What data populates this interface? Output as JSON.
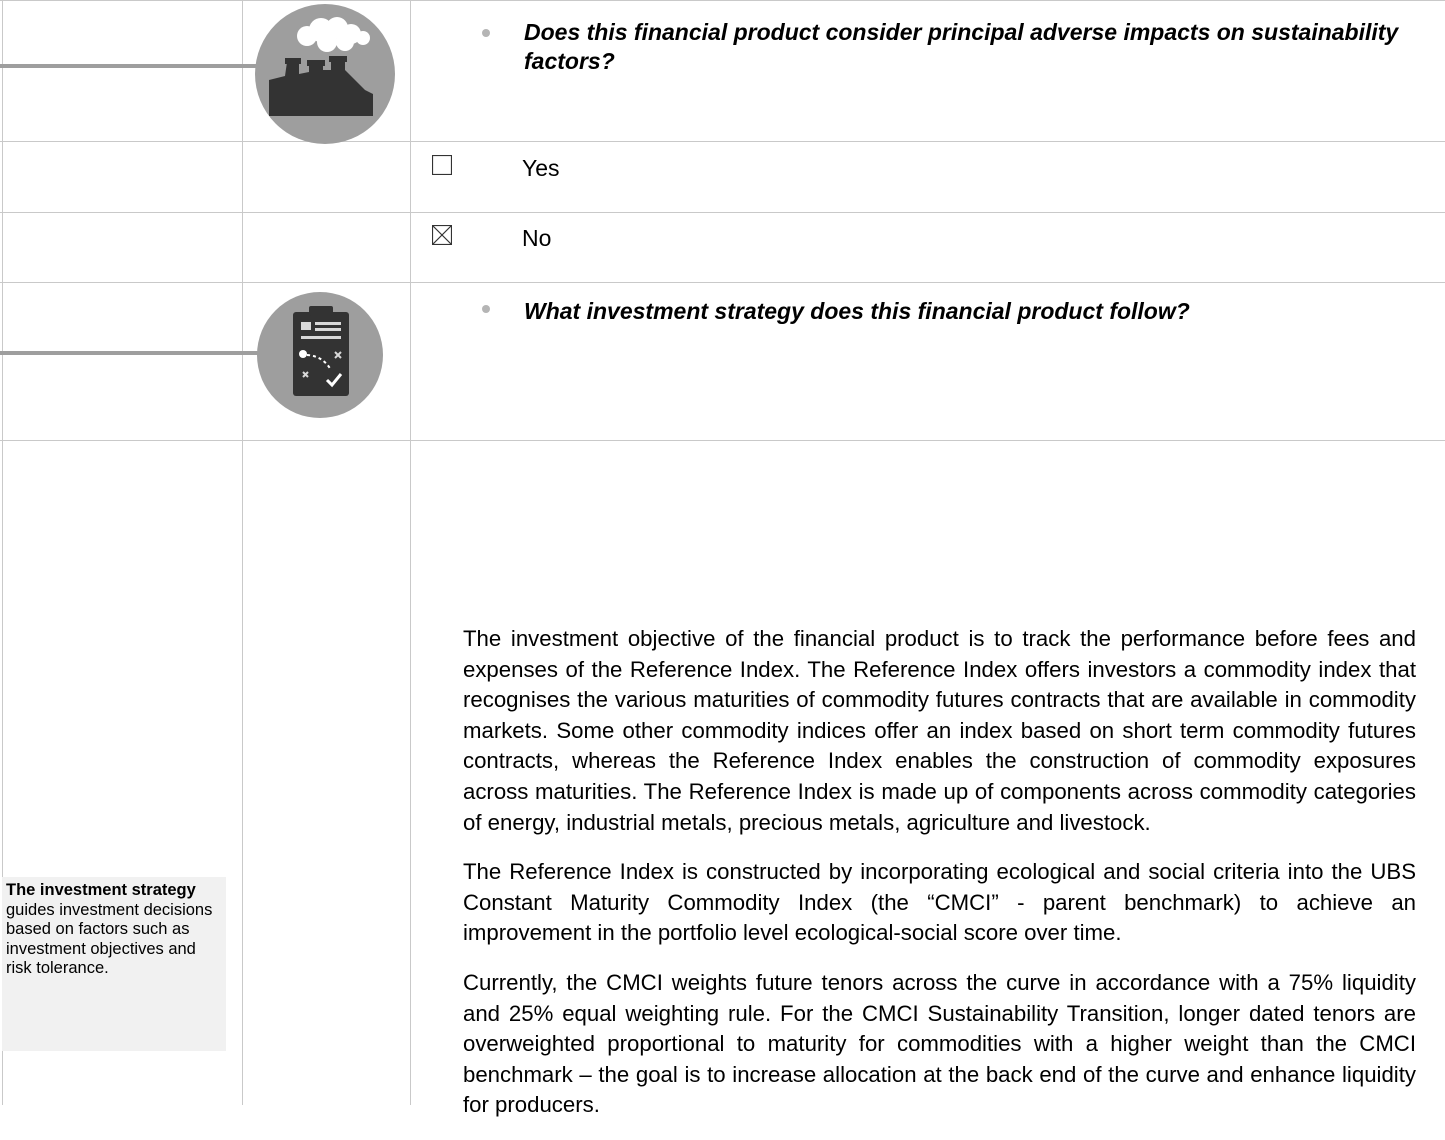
{
  "questions": {
    "pai": "Does this financial product consider principal adverse impacts on sustainability factors?",
    "strategy": "What investment strategy does this financial product follow?"
  },
  "options": [
    {
      "label": "Yes",
      "checked": false
    },
    {
      "label": "No",
      "checked": true
    }
  ],
  "icons": {
    "pai": "factory-smoke-icon",
    "strategy": "clipboard-strategy-icon"
  },
  "side_note": {
    "bold": "The investment strategy",
    "rest": " guides investment decisions based on factors such as investment objectives and risk tolerance."
  },
  "paragraphs": [
    "The investment objective of the financial product is to track the performance before fees and expenses of the Reference Index. The Reference Index offers investors a commodity index that recognises the various maturities of commodity futures contracts that are available in commodity markets. Some other commodity indices offer an index based on short term commodity futures contracts, whereas the Reference Index enables the construction of commodity exposures across maturities. The Reference Index is made up of components across commodity categories of energy, industrial metals, precious metals, agriculture and livestock.",
    "The Reference Index is constructed by incorporating ecological and social criteria into the UBS Constant Maturity Commodity Index (the “CMCI” - parent benchmark) to achieve an improvement in the portfolio level ecological-social score over time.",
    "Currently, the CMCI weights future tenors across the curve in accordance with a 75% liquidity and 25% equal weighting rule. For the CMCI Sustainability Transition, longer dated tenors are overweighted proportional to maturity for commodities with a higher weight than the CMCI benchmark – the goal is to increase allocation at the back end of the curve and enhance liquidity for producers."
  ]
}
